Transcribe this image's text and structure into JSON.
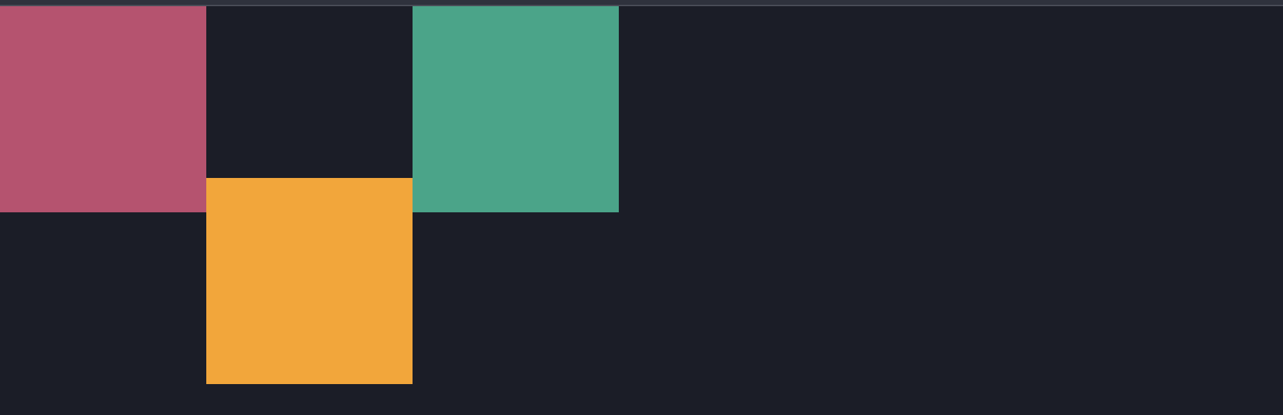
{
  "colors": {
    "background": "#1b1d27",
    "top_strip": "#2f323d"
  },
  "blocks": [
    {
      "color": "#b5536f"
    },
    {
      "color": "#f2a63b"
    },
    {
      "color": "#4ba489"
    }
  ]
}
